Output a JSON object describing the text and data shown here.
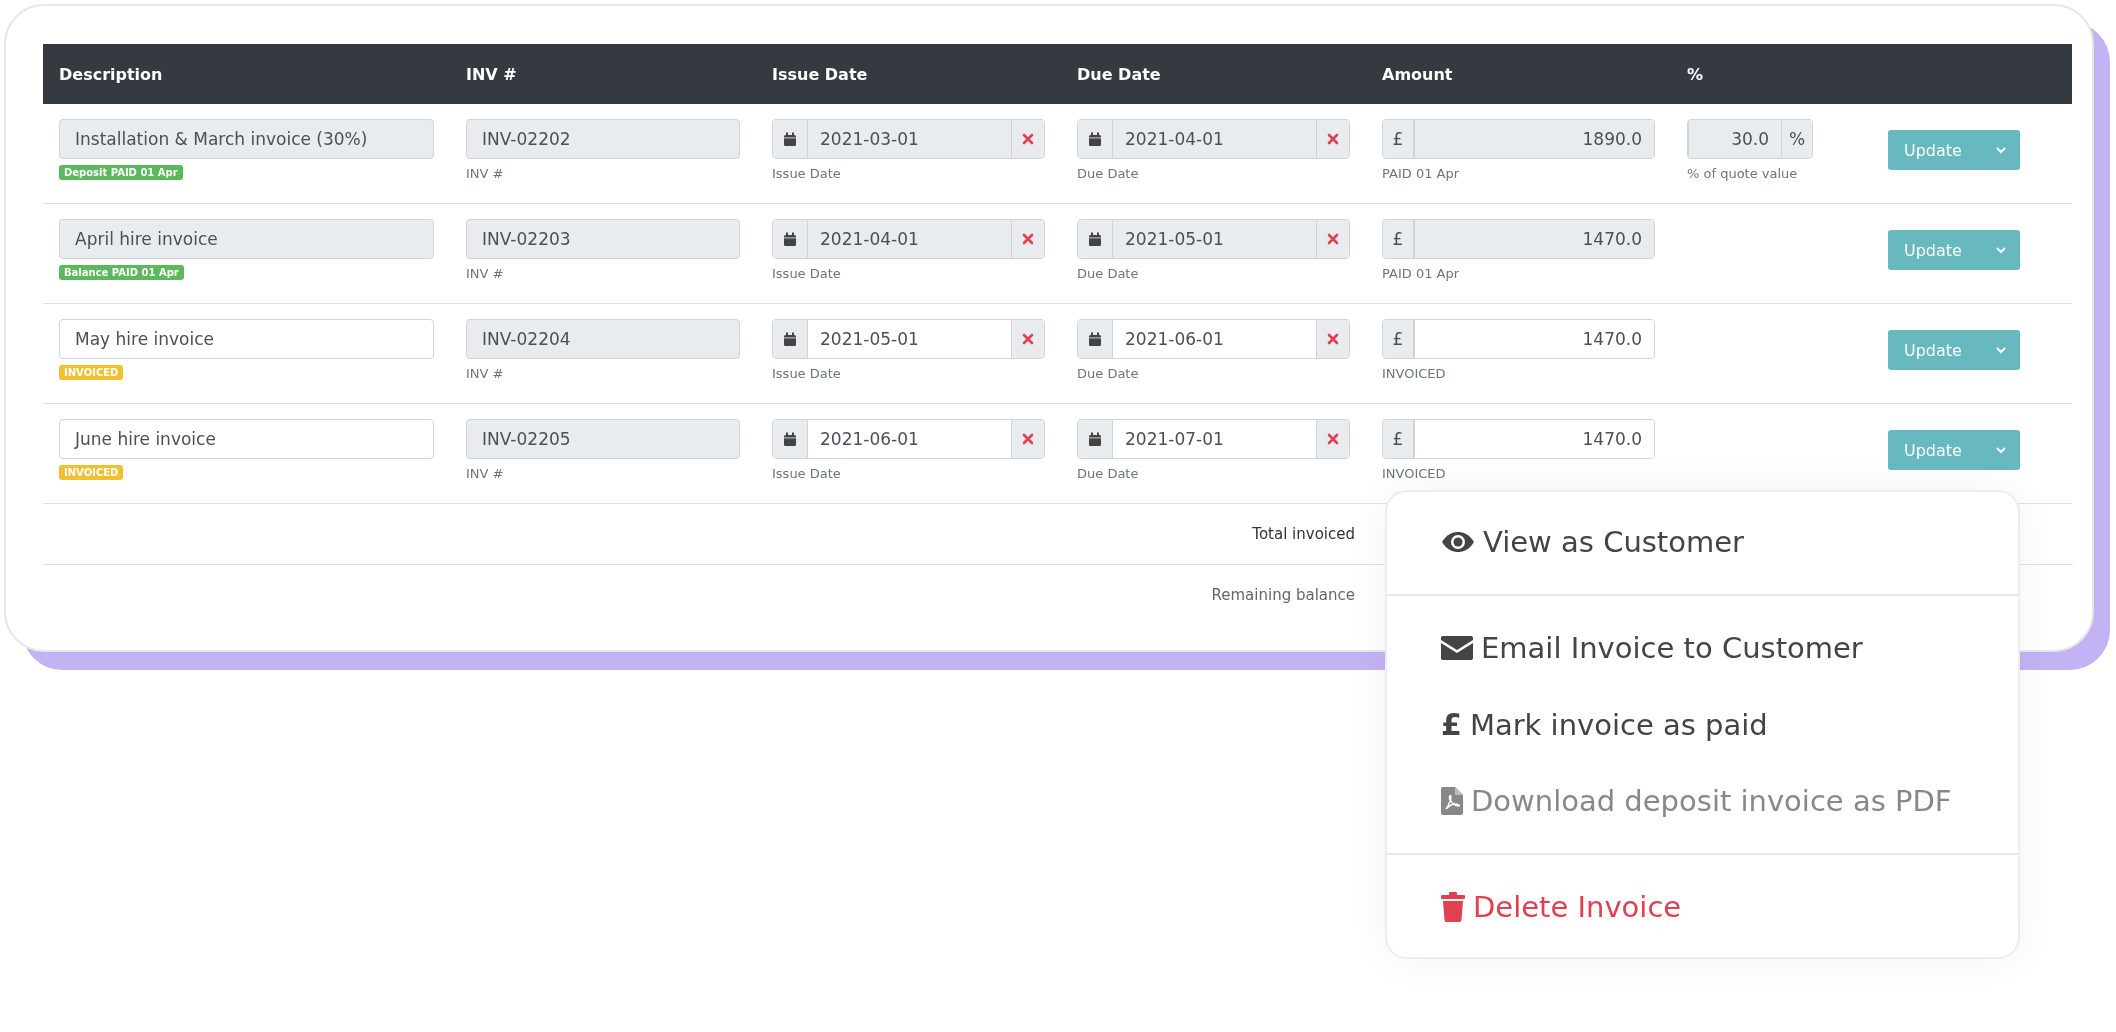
{
  "table": {
    "columns": [
      "Description",
      "INV #",
      "Issue Date",
      "Due Date",
      "Amount",
      "%"
    ],
    "rows": [
      {
        "locked": true,
        "description": "Installation & March invoice (30%)",
        "badge": {
          "text": "Deposit PAID 01 Apr",
          "color": "#5cb85c"
        },
        "inv": "INV-02202",
        "inv_hint": "INV #",
        "issue_date": "2021-03-01",
        "issue_hint": "Issue Date",
        "due_date": "2021-04-01",
        "due_hint": "Due Date",
        "currency": "£",
        "amount": "1890.0",
        "amount_hint": "PAID 01 Apr",
        "percent": {
          "value": "30.0",
          "suffix": "%",
          "hint": "% of quote value"
        },
        "button": "Update"
      },
      {
        "locked": true,
        "description": "April hire invoice",
        "badge": {
          "text": "Balance PAID 01 Apr",
          "color": "#5cb85c"
        },
        "inv": "INV-02203",
        "inv_hint": "INV #",
        "issue_date": "2021-04-01",
        "issue_hint": "Issue Date",
        "due_date": "2021-05-01",
        "due_hint": "Due Date",
        "currency": "£",
        "amount": "1470.0",
        "amount_hint": "PAID 01 Apr",
        "button": "Update"
      },
      {
        "locked": false,
        "description": "May hire invoice",
        "badge": {
          "text": "INVOICED",
          "color": "#f0c030"
        },
        "inv": "INV-02204",
        "inv_hint": "INV #",
        "issue_date": "2021-05-01",
        "issue_hint": "Issue Date",
        "due_date": "2021-06-01",
        "due_hint": "Due Date",
        "currency": "£",
        "amount": "1470.0",
        "amount_hint": "INVOICED",
        "button": "Update"
      },
      {
        "locked": false,
        "description": "June hire invoice",
        "badge": {
          "text": "INVOICED",
          "color": "#f0c030"
        },
        "inv": "INV-02205",
        "inv_hint": "INV #",
        "issue_date": "2021-06-01",
        "issue_hint": "Issue Date",
        "due_date": "2021-07-01",
        "due_hint": "Due Date",
        "currency": "£",
        "amount": "1470.0",
        "amount_hint": "INVOICED",
        "button": "Update"
      }
    ],
    "totals": [
      "Total invoiced",
      "Remaining balance"
    ]
  },
  "dropdown_menu": {
    "items": [
      {
        "kind": "item",
        "label": "View as Customer",
        "disabled": false,
        "danger": false
      },
      {
        "kind": "divider"
      },
      {
        "kind": "item",
        "label": "Email Invoice to Customer",
        "disabled": false,
        "danger": false
      },
      {
        "kind": "item",
        "glyph": "£",
        "label": "Mark invoice as paid",
        "disabled": false,
        "danger": false
      },
      {
        "kind": "item",
        "label": "Download deposit invoice as PDF",
        "disabled": true,
        "danger": false
      },
      {
        "kind": "divider"
      },
      {
        "kind": "item",
        "label": "Delete Invoice",
        "disabled": false,
        "danger": true
      }
    ]
  }
}
